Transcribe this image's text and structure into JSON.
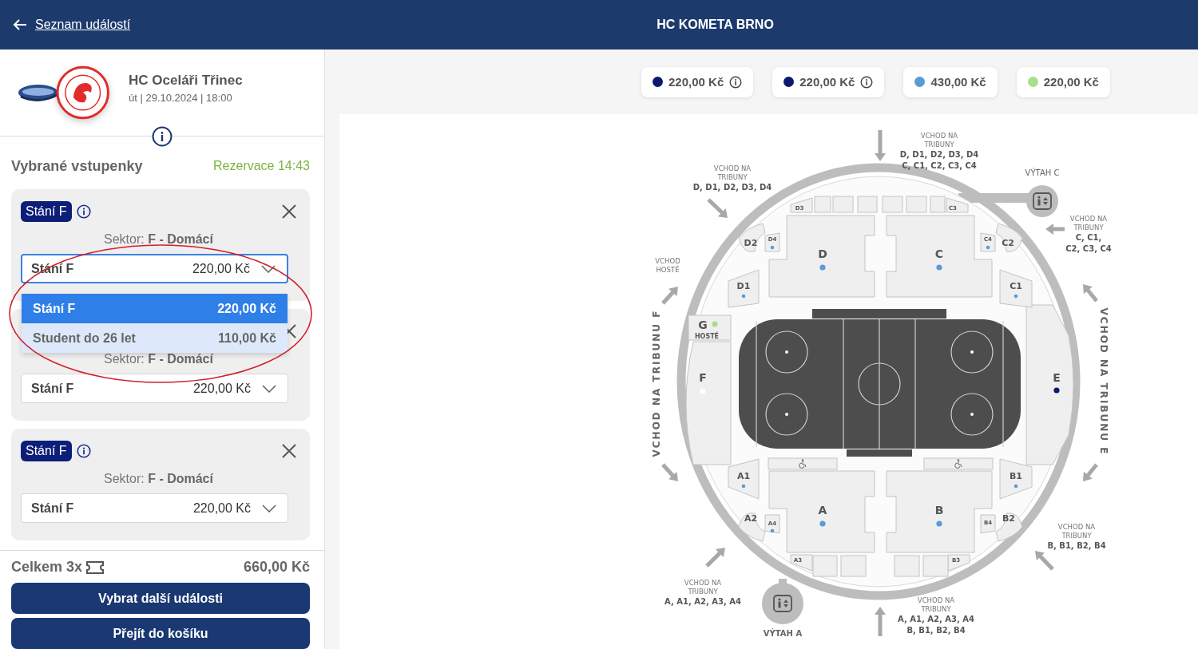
{
  "header": {
    "back_link": "Seznam událostí",
    "title": "HC KOMETA BRNO"
  },
  "event": {
    "name": "HC Oceláři Třinec",
    "details": "út | 29.10.2024 | 18:00"
  },
  "tickets": {
    "title": "Vybrané vstupenky",
    "reservation": "Rezervace 14:43",
    "items": [
      {
        "badge": "Stání F",
        "sector": "Sektor: **F - Domácí**",
        "select": {
          "label": "Stání F",
          "price": "220,00 Kč"
        },
        "expanded": true,
        "options": [
          {
            "label": "Stání F",
            "price": "220,00 Kč",
            "selected": true
          },
          {
            "label": "Student do 26 let",
            "price": "110,00 Kč",
            "selected": false
          }
        ]
      },
      {
        "sector": "Sektor: **F - Domácí**",
        "select": {
          "label": "Stání F",
          "price": "220,00 Kč"
        },
        "expanded": false
      },
      {
        "badge": "Stání F",
        "sector": "Sektor: **F - Domácí**",
        "select": {
          "label": "Stání F",
          "price": "220,00 Kč"
        },
        "expanded": false
      }
    ]
  },
  "total": {
    "label": "Celkem 3x",
    "price": "660,00 Kč"
  },
  "buttons": [
    "Vybrat další události",
    "Přejít do košíku"
  ],
  "legend": [
    {
      "price": "220,00 Kč",
      "color": "#0b1a6e",
      "info": true
    },
    {
      "price": "220,00 Kč",
      "color": "#0b1a6e",
      "info": true
    },
    {
      "price": "430,00 Kč",
      "color": "#5b9bd5",
      "info": false
    },
    {
      "price": "220,00 Kč",
      "color": "#a6e08a",
      "info": false
    }
  ],
  "map": {
    "sectors": [
      {
        "label": "D",
        "kind": "main",
        "color": "#5b9bd5"
      },
      {
        "label": "C",
        "kind": "main",
        "color": "#5b9bd5"
      },
      {
        "label": "E",
        "kind": "main",
        "color": "#0b1a6e"
      },
      {
        "label": "F",
        "kind": "main",
        "color": "#ffffff"
      },
      {
        "label": "G",
        "kind": "main",
        "color": "#a6e08a",
        "sublabel": "HOSTÉ"
      },
      {
        "label": "A",
        "kind": "main",
        "color": "#5b9bd5"
      },
      {
        "label": "B",
        "kind": "main",
        "color": "#5b9bd5"
      },
      {
        "label": "D1",
        "kind": "box",
        "color": "#5b9bd5"
      },
      {
        "label": "C1",
        "kind": "box",
        "color": "#5b9bd5"
      },
      {
        "label": "A1",
        "kind": "box",
        "color": "#5b9bd5"
      },
      {
        "label": "B1",
        "kind": "box",
        "color": "#5b9bd5"
      },
      {
        "label": "D2",
        "kind": "box"
      },
      {
        "label": "D4",
        "kind": "small",
        "color": "#5b9bd5"
      },
      {
        "label": "D3",
        "kind": "small"
      },
      {
        "label": "C3",
        "kind": "small"
      },
      {
        "label": "C4",
        "kind": "small",
        "color": "#5b9bd5"
      },
      {
        "label": "C2",
        "kind": "box"
      },
      {
        "label": "A2",
        "kind": "box"
      },
      {
        "label": "A4",
        "kind": "small",
        "color": "#5b9bd5"
      },
      {
        "label": "A3",
        "kind": "small"
      },
      {
        "label": "B3",
        "kind": "small"
      },
      {
        "label": "B4",
        "kind": "small"
      },
      {
        "label": "B2",
        "kind": "box"
      }
    ],
    "entrances": [
      {
        "heading": "VCHOD NA TRIBUNY",
        "sectors": [
          "D, D1, D2, D3, D4",
          "C, C1, C2, C3, C4"
        ]
      },
      {
        "heading": "VCHOD NA TRIBUNY",
        "sectors": [
          "D, D1, D2, D3, D4"
        ]
      },
      {
        "heading": "VCHOD HOSTÉ"
      },
      {
        "heading": "VCHOD NA TRIBUNY",
        "sectors": [
          "C, C1,",
          "C2, C3, C4"
        ]
      },
      {
        "heading": "VCHOD NA TRIBUNY",
        "sectors": [
          "A, A1, A2, A3, A4"
        ]
      },
      {
        "heading": "VCHOD NA TRIBUNY",
        "sectors": [
          "A, A1, A2, A3, A4",
          "B, B1, B2, B4"
        ]
      },
      {
        "heading": "VCHOD NA TRIBUNY",
        "sectors": [
          "B, B1, B2, B4"
        ]
      }
    ],
    "lifts": [
      "VÝTAH C",
      "VÝTAH A"
    ],
    "side_labels": [
      "VCHOD NA TRIBUNU F",
      "VCHOD NA TRIBUNU E"
    ]
  }
}
